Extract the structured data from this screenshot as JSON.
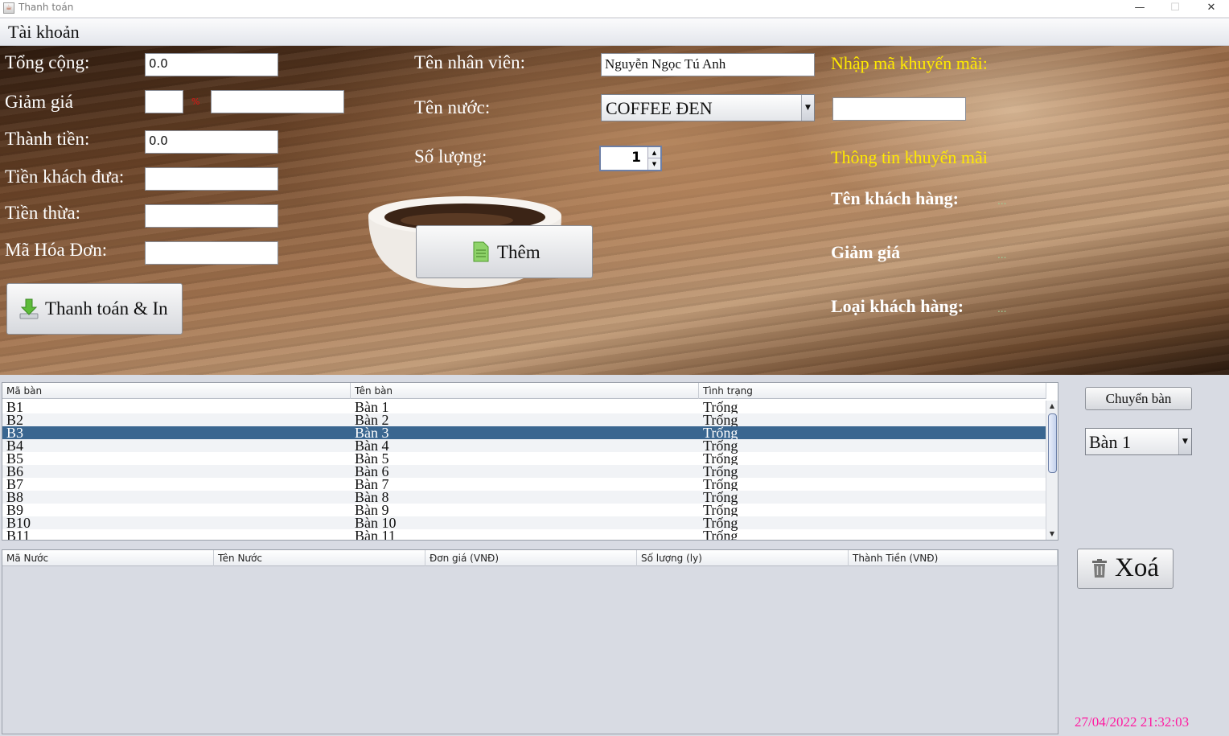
{
  "window": {
    "title": "Thanh toán",
    "minimize": "—",
    "maximize": "☐",
    "close": "✕"
  },
  "menu": {
    "account": "Tài khoản"
  },
  "payment": {
    "total_label": "Tổng cộng:",
    "total_value": "0.0",
    "discount_label": "Giảm giá",
    "discount_percent": "",
    "percent_sign": "%",
    "discount_amount": "",
    "amount_label": "Thành tiền:",
    "amount_value": "0.0",
    "cash_label": "Tiền khách đưa:",
    "cash_value": "",
    "change_label": "Tiền thừa:",
    "change_value": "",
    "invoice_label": "Mã Hóa Đơn:",
    "invoice_value": "",
    "pay_print_button": "Thanh toán & In"
  },
  "order": {
    "staff_label": "Tên nhân viên:",
    "staff_value": "Nguyễn Ngọc Tú Anh",
    "drink_label": "Tên nước:",
    "drink_value": "COFFEE ĐEN",
    "quantity_label": "Số lượng:",
    "quantity_value": "1",
    "add_button": "Thêm"
  },
  "promo": {
    "code_label": "Nhập mã khuyến mãi:",
    "code_value": "",
    "info_label": "Thông tin khuyến mãi",
    "customer_name_label": "Tên khách hàng:",
    "customer_name_value": "...",
    "discount_label": "Giảm giá",
    "discount_value": "...",
    "customer_type_label": "Loại khách hàng:",
    "customer_type_value": "..."
  },
  "tables_grid": {
    "headers": [
      "Mã bàn",
      "Tên bàn",
      "Tình trạng"
    ],
    "rows": [
      [
        "B1",
        "Bàn 1",
        "Trống"
      ],
      [
        "B2",
        "Bàn 2",
        "Trống"
      ],
      [
        "B3",
        "Bàn 3",
        "Trống"
      ],
      [
        "B4",
        "Bàn 4",
        "Trống"
      ],
      [
        "B5",
        "Bàn 5",
        "Trống"
      ],
      [
        "B6",
        "Bàn 6",
        "Trống"
      ],
      [
        "B7",
        "Bàn 7",
        "Trống"
      ],
      [
        "B8",
        "Bàn 8",
        "Trống"
      ],
      [
        "B9",
        "Bàn 9",
        "Trống"
      ],
      [
        "B10",
        "Bàn 10",
        "Trống"
      ],
      [
        "B11",
        "Bàn 11",
        "Trống"
      ]
    ],
    "selected_row": 2
  },
  "side": {
    "switch_table_button": "Chuyển bàn",
    "table_select_value": "Bàn 1",
    "delete_button": "Xoá"
  },
  "items_grid": {
    "headers": [
      "Mã Nước",
      "Tên Nước",
      "Đơn giá (VNĐ)",
      "Số lượng (ly)",
      "Thành Tiền (VNĐ)"
    ]
  },
  "status": {
    "datetime": "27/04/2022 21:32:03"
  },
  "colors": {
    "selected_row": "#3a6690",
    "promo_label": "#ffea00",
    "datetime": "#ff1aa0",
    "percent_sign": "#e01010"
  }
}
